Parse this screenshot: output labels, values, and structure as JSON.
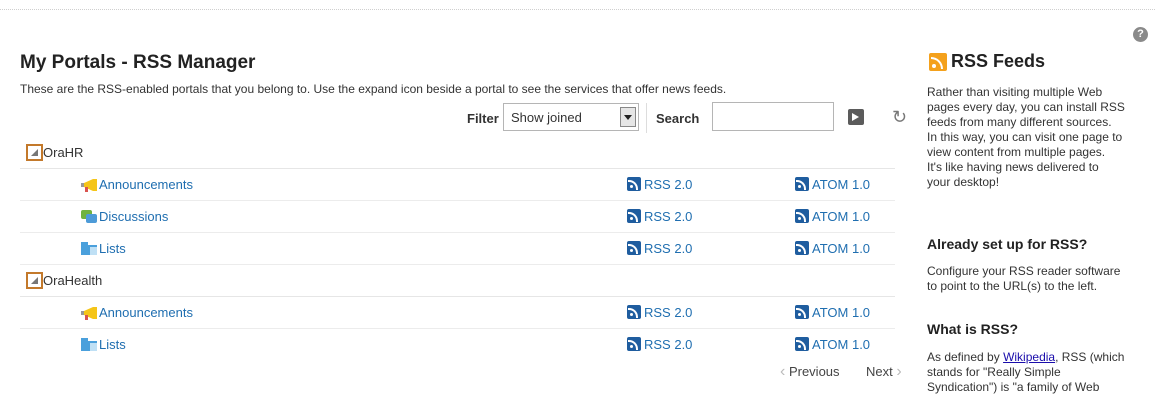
{
  "page": {
    "title": "My Portals - RSS Manager",
    "description": "These are the RSS-enabled portals that you belong to. Use the expand icon beside a portal to see the services that offer news feeds."
  },
  "toolbar": {
    "filter_label": "Filter",
    "filter_value": "Show joined",
    "search_label": "Search",
    "search_value": ""
  },
  "groups": [
    {
      "name": "OraHR",
      "services": [
        {
          "name": "Announcements",
          "icon": "megaphone-icon",
          "rss": "RSS 2.0",
          "atom": "ATOM 1.0"
        },
        {
          "name": "Discussions",
          "icon": "discussion-icon",
          "rss": "RSS 2.0",
          "atom": "ATOM 1.0"
        },
        {
          "name": "Lists",
          "icon": "list-folder-icon",
          "rss": "RSS 2.0",
          "atom": "ATOM 1.0"
        }
      ]
    },
    {
      "name": "OraHealth",
      "services": [
        {
          "name": "Announcements",
          "icon": "megaphone-icon",
          "rss": "RSS 2.0",
          "atom": "ATOM 1.0"
        },
        {
          "name": "Lists",
          "icon": "list-folder-icon",
          "rss": "RSS 2.0",
          "atom": "ATOM 1.0"
        }
      ]
    }
  ],
  "pager": {
    "previous": "Previous",
    "next": "Next"
  },
  "sidebar": {
    "title": "RSS Feeds",
    "intro": "Rather than visiting multiple Web\npages every day, you can install RSS\nfeeds from many different sources.\nIn this way, you can visit one page to\nview content from multiple pages.\nIt's like having news delivered to\nyour desktop!",
    "setup_heading": "Already set up for RSS?",
    "setup_text": "Configure your RSS reader software\nto point to the URL(s) to the left.",
    "what_heading": "What is RSS?",
    "what_prefix": "As defined by ",
    "what_link": "Wikipedia",
    "what_suffix": ", RSS (which",
    "what_rest": "stands for \"Really Simple\nSyndication\") is \"a family of Web"
  },
  "colors": {
    "link": "#1f6eb0",
    "expander_border": "#c3792b",
    "rss_orange": "#f4a11c"
  }
}
